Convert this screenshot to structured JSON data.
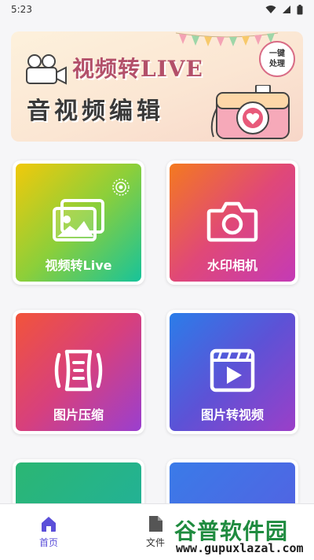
{
  "status_bar": {
    "time": "5:23"
  },
  "banner": {
    "title_line1": "视频转LIVE",
    "title_line2": "音视频编辑",
    "badge_line1": "一键",
    "badge_line2": "处理"
  },
  "features": [
    {
      "label": "视频转Live",
      "icon": "live-photo-icon"
    },
    {
      "label": "水印相机",
      "icon": "camera-icon"
    },
    {
      "label": "图片压缩",
      "icon": "compress-icon"
    },
    {
      "label": "图片转视频",
      "icon": "video-clapper-icon"
    },
    {
      "label": "",
      "icon": "upload-icon"
    },
    {
      "label": "",
      "icon": "film-strip-icon"
    }
  ],
  "tabbar": {
    "home_label": "首页",
    "files_label": "文件",
    "active_color": "#5b4fd9"
  },
  "watermark": {
    "brand": "谷普软件园",
    "url": "www.gupuxlazal.com"
  }
}
